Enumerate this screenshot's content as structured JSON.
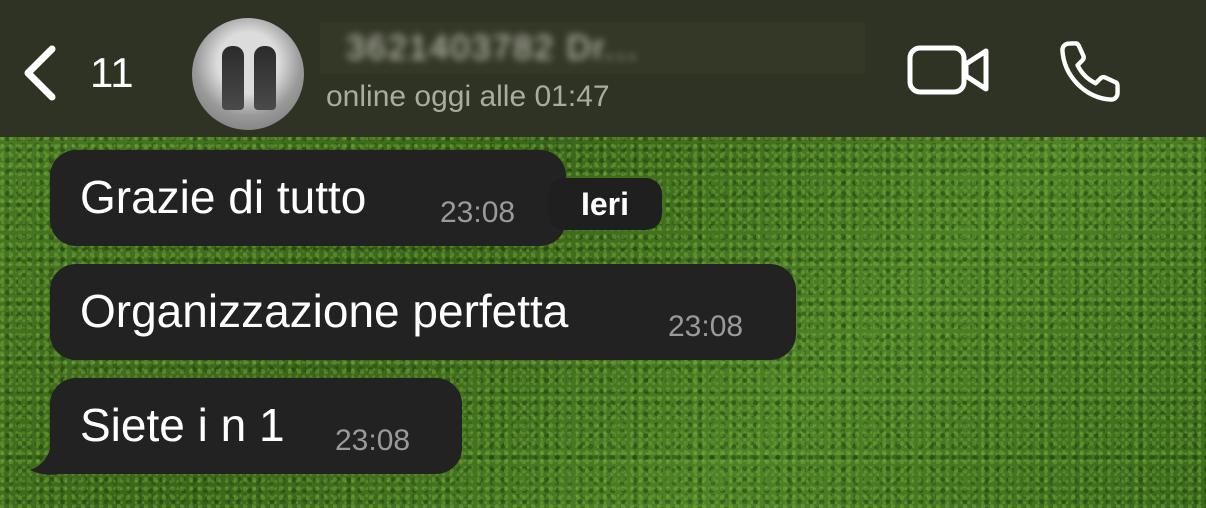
{
  "header": {
    "back_count": "11",
    "contact_name": "3621403782 Dr...",
    "status": "online oggi alle 01:47",
    "icons": {
      "back": "chevron-left-icon",
      "video": "video-camera-icon",
      "call": "phone-icon"
    }
  },
  "date_separator": "Ieri",
  "messages": [
    {
      "text": "Grazie di tutto",
      "time": "23:08"
    },
    {
      "text": "Organizzazione perfetta",
      "time": "23:08"
    },
    {
      "text": "Siete i n 1",
      "time": "23:08"
    }
  ],
  "colors": {
    "header_bg": "#2f3323",
    "bubble_bg": "#222222",
    "time_text": "#9a9a9a",
    "wallpaper": "#3f6b1f"
  }
}
